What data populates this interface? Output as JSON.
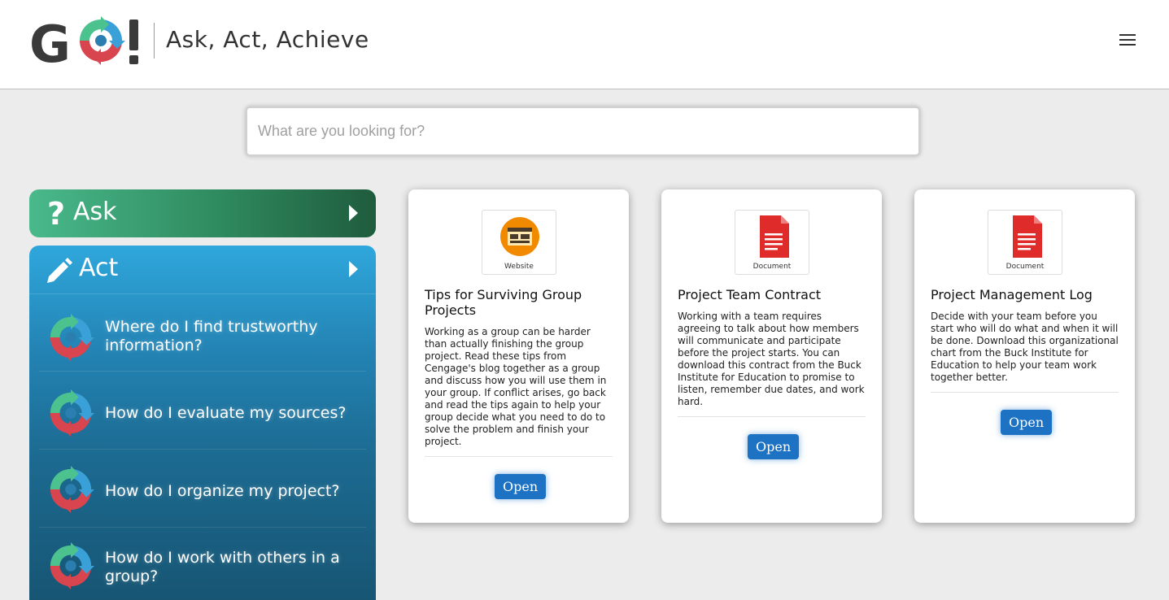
{
  "header": {
    "logo_text": "GO!",
    "tagline": "Ask, Act, Achieve",
    "menu_icon": "hamburger-menu-icon"
  },
  "search": {
    "placeholder": "What are you looking for?",
    "value": ""
  },
  "sidebar": {
    "ask": {
      "label": "Ask",
      "icon": "question-mark-icon",
      "arrow": "caret-right-icon"
    },
    "act": {
      "label": "Act",
      "icon": "pencil-icon",
      "arrow": "caret-right-icon",
      "items": [
        {
          "label": "Where do I find trustworthy information?",
          "icon": "go-cycle-icon"
        },
        {
          "label": "How do I evaluate my sources?",
          "icon": "go-cycle-icon"
        },
        {
          "label": "How do I organize my project?",
          "icon": "go-cycle-icon"
        },
        {
          "label": "How do I work with others in a group?",
          "icon": "go-cycle-icon"
        }
      ]
    }
  },
  "cards": [
    {
      "type_label": "Website",
      "icon": "website-icon",
      "title": "Tips for Surviving Group Projects",
      "description": "Working as a group can be harder than actually finishing the group project. Read these tips from Cengage's blog together as a group and discuss how you will use them in your group. If conflict arises, go back and read the tips again to help your group decide what you need to do to solve the problem and finish your project.",
      "button": "Open"
    },
    {
      "type_label": "Document",
      "icon": "document-icon",
      "title": "Project Team Contract",
      "description": "Working with a team requires agreeing to talk about how members will communicate and participate before the project starts. You can download this contract from the Buck Institute for Education to promise to listen, remember due dates, and work hard.",
      "button": "Open"
    },
    {
      "type_label": "Document",
      "icon": "document-icon",
      "title": "Project Management Log",
      "description": "Decide with your team before you start who will do what and when it will be done. Download this organizational chart from the Buck Institute for Education to help your team work together better.",
      "button": "Open"
    }
  ],
  "colors": {
    "ask_green": "#2f8a5f",
    "act_blue": "#2383b3",
    "open_button": "#1d72c4"
  }
}
